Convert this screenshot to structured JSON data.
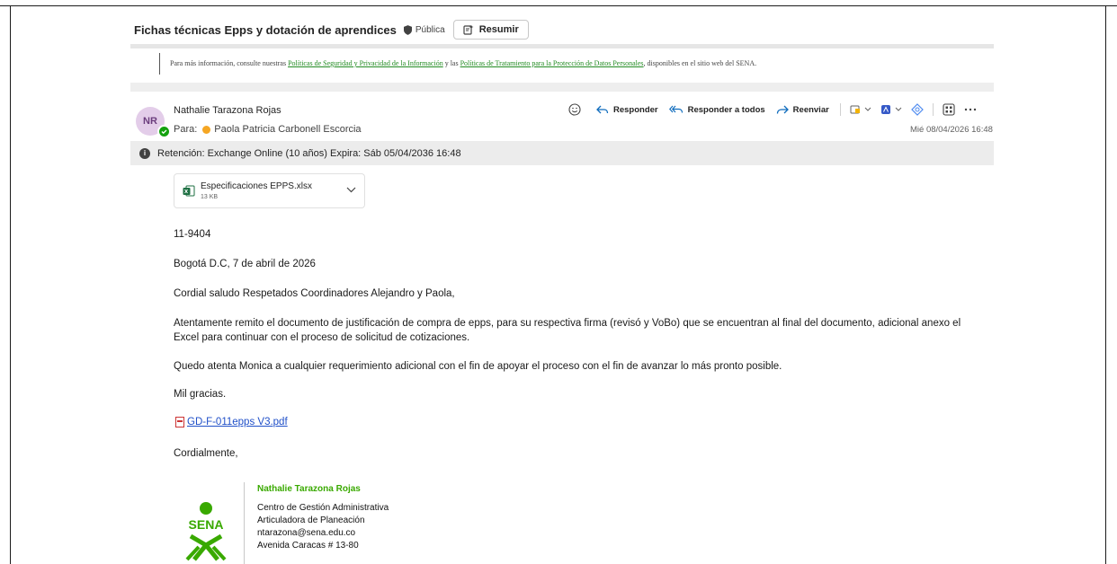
{
  "subject": {
    "title": "Fichas técnicas Epps y dotación de aprendices",
    "sensitivity": "Pública",
    "summarize_label": "Resumir"
  },
  "info_banner": {
    "pre": "Para más información, consulte nuestras ",
    "link1": "Políticas de Seguridad y Privacidad de la Información",
    "mid": " y las ",
    "link2": "Políticas de Tratamiento para la Protección de Datos Personales",
    "post": ", disponibles en el sitio web del SENA."
  },
  "message": {
    "avatar_initials": "NR",
    "sender": "Nathalie Tarazona Rojas",
    "to_label": "Para:",
    "to_name": "Paola Patricia Carbonell Escorcia",
    "date": "Mié 08/04/2026 16:48",
    "actions": {
      "reply": "Responder",
      "reply_all": "Responder a todos",
      "forward": "Reenviar"
    }
  },
  "retention": {
    "text": "Retención: Exchange Online (10 años) Expira: Sáb 05/04/2036 16:48"
  },
  "attachment": {
    "name": "Especificaciones EPPS.xlsx",
    "size": "13 KB"
  },
  "body": {
    "ref": "11-9404",
    "place_date": "Bogotá D.C, 7 de abril de 2026",
    "greeting": "Cordial saludo Respetados Coordinadores Alejandro y Paola,",
    "para1": "Atentamente remito el documento de justificación de compra de epps, para su respectiva firma (revisó y VoBo) que se encuentran al final del documento, adicional anexo el Excel para continuar con el proceso de solicitud de cotizaciones.",
    "para2": "Quedo atenta Monica a cualquier requerimiento adicional con el fin de apoyar el proceso con el fin de avanzar lo más pronto posible.",
    "thanks": "Mil gracias.",
    "link": "GD-F-011epps  V3.pdf",
    "closing": "Cordialmente,"
  },
  "signature": {
    "logo_text": "SENA",
    "name": "Nathalie Tarazona Rojas",
    "line1": "Centro de Gestión Administrativa",
    "line2": "Articuladora de Planeación",
    "line3": "ntarazona@sena.edu.co",
    "line4": "Avenida Caracas # 13-80"
  },
  "colors": {
    "sena_green": "#39a900",
    "link_blue": "#1f4fc8",
    "accent_blue": "#0f6cbd"
  }
}
